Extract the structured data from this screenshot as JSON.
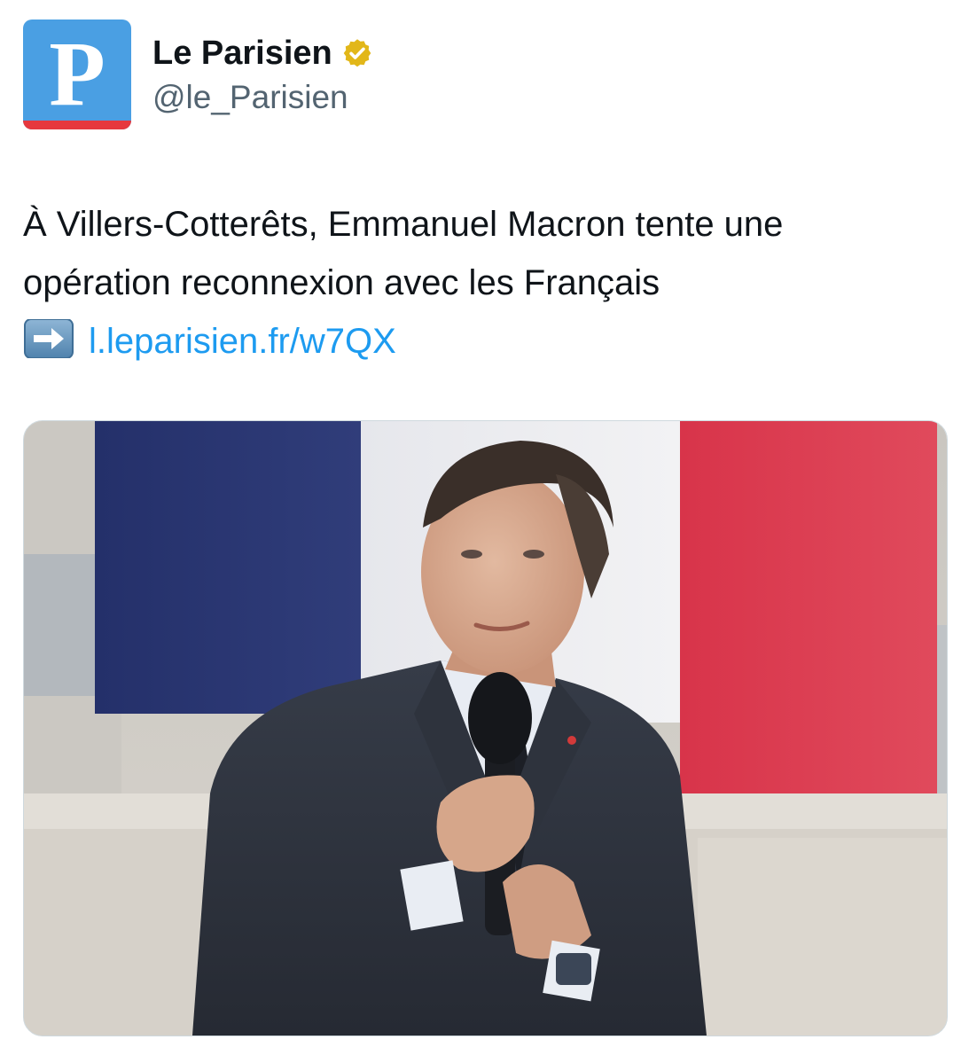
{
  "account": {
    "avatar_letter": "P",
    "display_name": "Le Parisien",
    "handle": "@le_Parisien",
    "verified_badge": "verified-gold-icon"
  },
  "tweet": {
    "line1": "À Villers-Cotterêts, Emmanuel Macron tente une",
    "line2": "opération reconnexion avec les Français",
    "arrow_icon": "right-arrow-emoji-icon",
    "link_text": "l.leparisien.fr/w7QX"
  },
  "colors": {
    "brand_blue": "#4a9fe3",
    "brand_red": "#e6383e",
    "link_blue": "#1d9bf0",
    "verified_gold": "#e2b719",
    "text_primary": "#0f1419",
    "text_secondary": "#536471"
  }
}
